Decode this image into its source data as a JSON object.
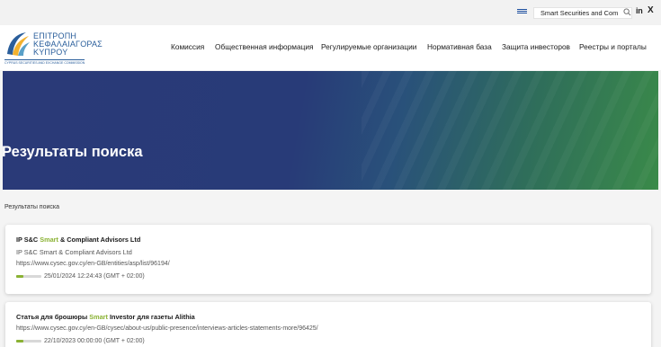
{
  "topbar": {
    "search_value": "Smart Securities and Com",
    "icons": [
      "greece-flag-icon",
      "search-icon",
      "linkedin-icon",
      "x-icon"
    ],
    "linkedin_label": "in",
    "x_label": "X"
  },
  "logo": {
    "line1": "ΕΠΙΤΡΟΠΗ",
    "line2": "ΚΕΦΑΛΑΙΑΓΟΡΑΣ",
    "line3": "ΚΥΠΡΟΥ",
    "subtitle": "CYPRUS SECURITIES AND EXCHANGE COMMISSION"
  },
  "nav": {
    "items": [
      "Комиссия",
      "Общественная информация",
      "Регулируемые организации",
      "Нормативная база",
      "Защита инвесторов",
      "Реестры и порталы"
    ]
  },
  "hero": {
    "title": "Результаты поиска"
  },
  "breadcrumb": "Результаты поиска",
  "results": [
    {
      "title_before": "IP S&C ",
      "title_highlight": "Smart",
      "title_after": " & Compliant Advisors Ltd",
      "subtitle": "IP S&C Smart & Compliant Advisors Ltd",
      "url": "https://www.cysec.gov.cy/en-GB/entities/asp/list/96194/",
      "relevance": 0.3,
      "date": "25/01/2024 12:24:43 (GMT + 02:00)"
    },
    {
      "title_before": "Статья для брошюры ",
      "title_highlight": "Smart",
      "title_after": " Investor для газеты Alithia",
      "url": "https://www.cysec.gov.cy/en-GB/cysec/about-us/public-presence/interviews-articles-statements-more/96425/",
      "relevance": 0.3,
      "date": "22/10/2023 00:00:00 (GMT + 02:00)"
    }
  ],
  "colors": {
    "accent_green": "#8ab233",
    "hero_blue": "#2a3a78",
    "hero_green": "#3a8a49",
    "logo_blue": "#2a5e9b"
  }
}
